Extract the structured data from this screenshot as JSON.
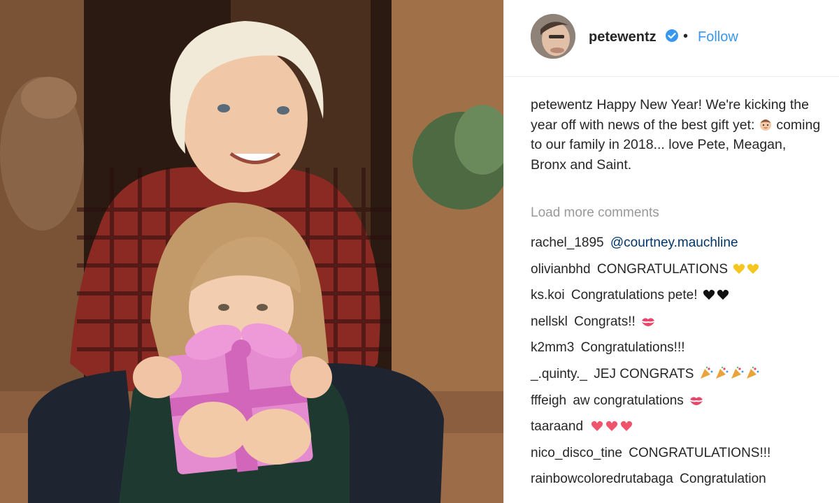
{
  "post": {
    "username": "petewentz",
    "follow_label": "Follow",
    "separator": "•",
    "verified_icon": "verified-badge-icon",
    "caption_user": "petewentz",
    "caption_before_emoji": "Happy New Year! We're kicking the year off with news of the best gift yet:",
    "caption_after_emoji": "coming to our family in 2018... love Pete, Meagan, Bronx and Saint.",
    "caption_emoji": "baby-face-emoji"
  },
  "load_more_label": "Load more comments",
  "comments": [
    {
      "user": "rachel_1895",
      "text": "@courtney.mauchline",
      "mention": true,
      "emoji": ""
    },
    {
      "user": "olivianbhd",
      "text": "CONGRATULATIONS",
      "mention": false,
      "emoji": "yellow-hearts"
    },
    {
      "user": "ks.koi",
      "text": "Congratulations pete!",
      "mention": false,
      "emoji": "black-hearts"
    },
    {
      "user": "nellskl",
      "text": "Congrats!!",
      "mention": false,
      "emoji": "kiss-mark"
    },
    {
      "user": "k2mm3",
      "text": "Congratulations!!!",
      "mention": false,
      "emoji": ""
    },
    {
      "user": "_.quinty._",
      "text": "JEJ CONGRATS",
      "mention": false,
      "emoji": "party-poppers"
    },
    {
      "user": "fffeigh",
      "text": "aw congratulations",
      "mention": false,
      "emoji": "kiss-mark"
    },
    {
      "user": "taaraand",
      "text": "",
      "mention": false,
      "emoji": "red-hearts"
    },
    {
      "user": "nico_disco_tine",
      "text": "CONGRATULATIONS!!!",
      "mention": false,
      "emoji": ""
    },
    {
      "user": "rainbowcoloredrutabaga",
      "text": "Congratulation",
      "mention": false,
      "emoji": ""
    }
  ],
  "colors": {
    "link_blue": "#3897f0",
    "mention_blue": "#003569",
    "muted_gray": "#999999",
    "text": "#262626",
    "gift_pink": "#e58bd0"
  }
}
